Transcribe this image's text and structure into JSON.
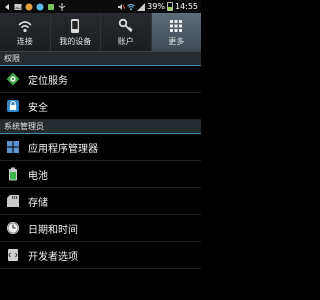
{
  "status_bar": {
    "battery_percent": "39%",
    "time": "14:55",
    "left_icons": [
      "back-icon",
      "image-icon",
      "notification-icon",
      "notification-icon-2",
      "notification-icon-3",
      "usb-icon"
    ],
    "right_icons": [
      "mute-icon",
      "wifi-icon",
      "signal-icon",
      "battery-icon"
    ]
  },
  "tabs": [
    {
      "label": "连接",
      "icon": "wifi-icon",
      "active": false
    },
    {
      "label": "我的设备",
      "icon": "phone-icon",
      "active": false
    },
    {
      "label": "账户",
      "icon": "key-icon",
      "active": false
    },
    {
      "label": "更多",
      "icon": "grid-icon",
      "active": true
    }
  ],
  "sections": [
    {
      "header": "权限",
      "items": [
        {
          "label": "定位服务",
          "icon": "location-icon"
        },
        {
          "label": "安全",
          "icon": "lock-icon"
        }
      ]
    },
    {
      "header": "系统管理员",
      "items": [
        {
          "label": "应用程序管理器",
          "icon": "app-grid-icon"
        },
        {
          "label": "电池",
          "icon": "battery-icon"
        },
        {
          "label": "存储",
          "icon": "storage-icon"
        },
        {
          "label": "日期和时间",
          "icon": "clock-icon"
        },
        {
          "label": "开发者选项",
          "icon": "developer-icon"
        }
      ]
    }
  ],
  "colors": {
    "accent": "#3d89b8",
    "tab_active": "#4f5c68",
    "section_bg": "#262b30"
  }
}
